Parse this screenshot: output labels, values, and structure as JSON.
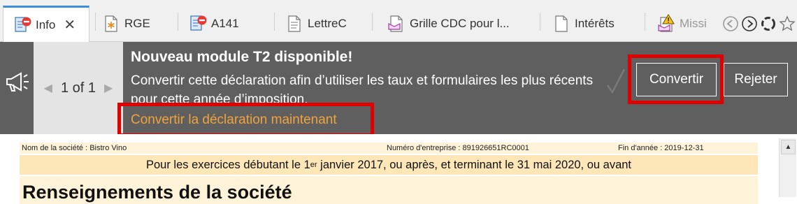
{
  "tabs": [
    {
      "label": "Info",
      "icon": "document-no-entry-icon",
      "active": true,
      "close_glyph": "✕"
    },
    {
      "label": "RGE",
      "icon": "asterisk-document-icon"
    },
    {
      "label": "A141",
      "icon": "document-no-entry-icon"
    },
    {
      "label": "LettreC",
      "icon": "text-document-icon"
    },
    {
      "label": "Grille CDC pour l...",
      "icon": "letter-document-icon"
    },
    {
      "label": "Intérêts",
      "icon": "blank-document-icon"
    },
    {
      "label": "Missi",
      "icon": "warning-document-icon"
    }
  ],
  "nav_icons": [
    "back-circle-icon",
    "forward-circle-icon",
    "refresh-icon",
    "star-icon"
  ],
  "banner": {
    "pager": {
      "prev": "◀",
      "text": "1 of 1",
      "next": "▶"
    },
    "title": "Nouveau module T2 disponible!",
    "message": "Convertir cette déclaration afin d’utiliser les taux et formulaires les plus récents pour cette année d’imposition.",
    "link": "Convertir la déclaration maintenant",
    "convert_button": "Convertir",
    "reject_button": "Rejeter",
    "colors": {
      "background": "#5f5f5f",
      "link": "#f2a23c",
      "highlight": "#e00000"
    }
  },
  "document": {
    "company_label": "Nom de la société : Bistro Vino",
    "business_number_label": "Numéro d'entreprise : 891926651RC0001",
    "year_end_label": "Fin d'année : 2019-12-31",
    "period_before": "Pour les exercices débutant le 1",
    "period_sup": "er",
    "period_after": " janvier 2017, ou après, et terminant le 31 mai 2020, ou avant",
    "section_title": "Renseignements de la société"
  }
}
